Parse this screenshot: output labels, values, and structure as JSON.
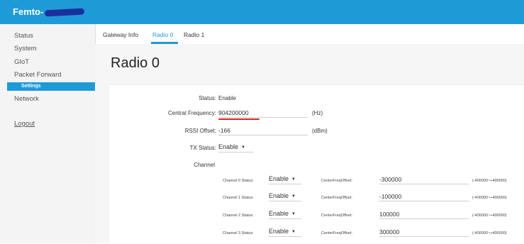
{
  "header": {
    "brand": "Femto-"
  },
  "sidebar": {
    "items": [
      {
        "label": "Status"
      },
      {
        "label": "System"
      },
      {
        "label": "GIoT"
      },
      {
        "label": "Packet Forward"
      },
      {
        "label": "Settings"
      },
      {
        "label": "Network"
      },
      {
        "label": "Logout"
      }
    ]
  },
  "tabs": [
    {
      "label": "Gateway Info"
    },
    {
      "label": "Radio 0"
    },
    {
      "label": "Radio 1"
    }
  ],
  "page": {
    "title": "Radio 0"
  },
  "form": {
    "status_label": "Status:",
    "status_value": "Enable",
    "freq_label": "Central Frequency:",
    "freq_value": "904200000",
    "freq_unit": "(Hz)",
    "rssi_label": "RSSI Offset:",
    "rssi_value": "-166",
    "rssi_unit": "(dBm)",
    "tx_label": "TX Status:",
    "tx_value": "Enable",
    "channel_heading": "Channel"
  },
  "channels": [
    {
      "status_label": "Channel 0 Status:",
      "status_value": "Enable",
      "offset_label": "CenterFreqOffset:",
      "offset_value": "-300000",
      "range": "(-400000~+400000)"
    },
    {
      "status_label": "Channel 1 Status:",
      "status_value": "Enable",
      "offset_label": "CenterFreqOffset:",
      "offset_value": "-100000",
      "range": "(-400000~+400000)"
    },
    {
      "status_label": "Channel 2 Status:",
      "status_value": "Enable",
      "offset_label": "CenterFreqOffset:",
      "offset_value": "100000",
      "range": "(-400000~+400000)"
    },
    {
      "status_label": "Channel 3 Status:",
      "status_value": "Enable",
      "offset_label": "CenterFreqOffset:",
      "offset_value": "300000",
      "range": "(-400000~+400000)"
    }
  ],
  "colors": {
    "accent": "#1e9ad6",
    "redaction": "#1a2f9e",
    "annotation": "#dd2222"
  }
}
